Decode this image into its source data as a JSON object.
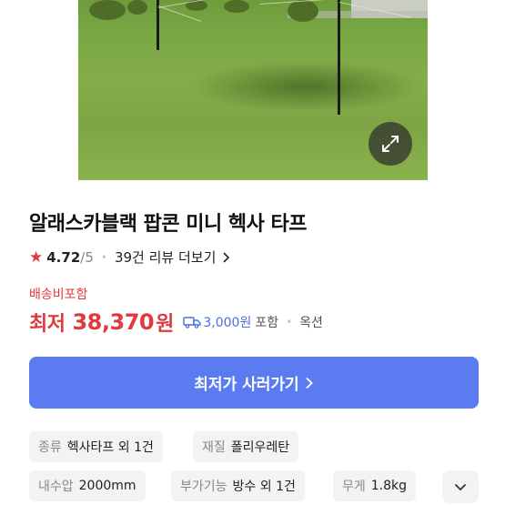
{
  "product": {
    "title": "알래스카블랙 팝콘 미니 헥사 타프",
    "rating": "4.72",
    "rating_max": "/5",
    "review_link": "39건 리뷰 더보기"
  },
  "pricing": {
    "shipping_included": "배송비포함",
    "price_label": "최저",
    "price_value": "38,370",
    "price_unit": "원",
    "shipping_fee": "3,000원",
    "shipping_fee_suffix": "포함",
    "option": "옥션"
  },
  "cta": {
    "label": "최저가 사러가기"
  },
  "specs": [
    {
      "key": "종류",
      "value": "헥사타프 외 1건"
    },
    {
      "key": "재질",
      "value": "폴리우레탄"
    },
    {
      "key": "내수압",
      "value": "2000mm"
    },
    {
      "key": "부가기능",
      "value": "방수 외 1건"
    },
    {
      "key": "무게",
      "value": "1.8kg"
    }
  ],
  "colors": {
    "accent_red": "#e0393e",
    "cta_blue": "#5b7cf0",
    "link_blue": "#4a6ee0"
  },
  "icons": {
    "rating": "star-icon",
    "expand": "expand-icon",
    "shipping": "truck-icon",
    "cta": "chevron-right-icon",
    "more": "chevron-down-icon"
  }
}
